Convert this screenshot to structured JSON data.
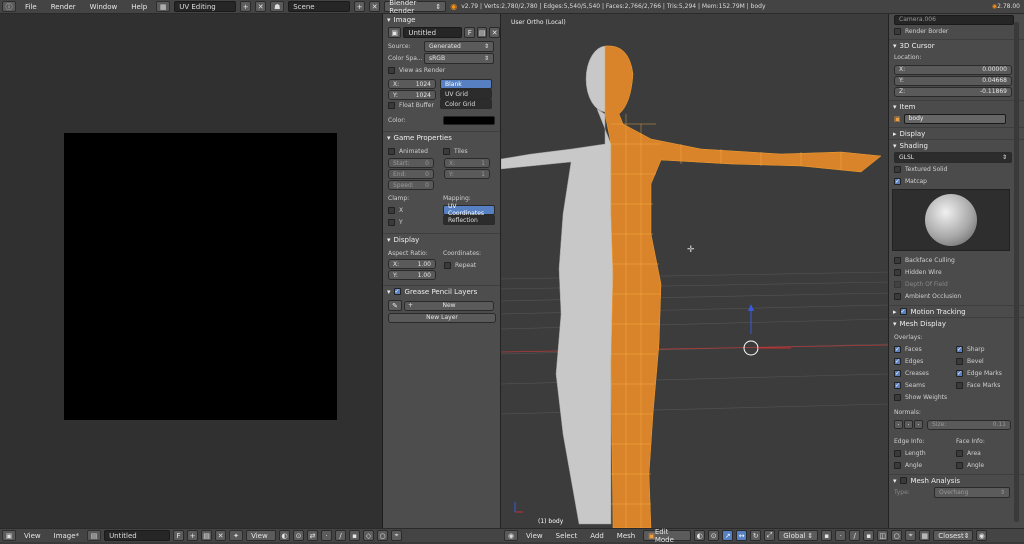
{
  "topbar": {
    "menus": [
      "File",
      "Render",
      "Window",
      "Help"
    ],
    "layout": "UV Editing",
    "scene": "Scene",
    "engine": "Blender Render",
    "stats": "v2.79 | Verts:2,780/2,780 | Edges:5,540/5,540 | Faces:2,766/2,766 | Tris:5,294 | Mem:152.79M | body",
    "version": "2.78.00"
  },
  "image_panel": {
    "header": "Image",
    "image_name": "Untitled",
    "source_label": "Source:",
    "source_value": "Generated",
    "colorspace_label": "Color Spa...",
    "colorspace_value": "sRGB",
    "view_as_render": "View as Render",
    "x_label": "X:",
    "x_value": "1024",
    "y_label": "Y:",
    "y_value": "1024",
    "gen_types": [
      "Blank",
      "UV Grid",
      "Color Grid"
    ],
    "float_buffer": "Float Buffer",
    "color_label": "Color:"
  },
  "game_panel": {
    "header": "Game Properties",
    "animated": "Animated",
    "tiles": "Tiles",
    "start": "Start:",
    "start_val": "0",
    "end": "End:",
    "end_val": "0",
    "speed": "Speed:",
    "speed_val": "0",
    "tx": "X:",
    "tx_val": "1",
    "ty": "Y:",
    "ty_val": "1",
    "clamp": "Clamp:",
    "mapping": "Mapping:",
    "cx": "X",
    "cy": "Y",
    "map_uv": "UV Coordinates",
    "map_refl": "Reflection"
  },
  "display_panel": {
    "header": "Display",
    "aspect": "Aspect Ratio:",
    "coords": "Coordinates:",
    "ax": "X:",
    "ax_val": "1.00",
    "ay": "Y:",
    "ay_val": "1.00",
    "repeat": "Repeat"
  },
  "gp_panel": {
    "header": "Grease Pencil Layers",
    "new": "New",
    "new_layer": "New Layer"
  },
  "viewport": {
    "title": "User Ortho (Local)",
    "object_label": "(1) body"
  },
  "npanel": {
    "camera": "Camera.006",
    "render_border": "Render Border",
    "cursor_header": "3D Cursor",
    "location": "Location:",
    "cx": "X:",
    "cx_val": "0.00000",
    "cy": "Y:",
    "cy_val": "0.04668",
    "cz": "Z:",
    "cz_val": "-0.11869",
    "item_header": "Item",
    "item_name": "body",
    "display_header": "Display",
    "shading_header": "Shading",
    "shading_mode": "GLSL",
    "textured_solid": "Textured Solid",
    "matcap": "Matcap",
    "backface": "Backface Culling",
    "hidden_wire": "Hidden Wire",
    "dof": "Depth Of Field",
    "ao": "Ambient Occlusion",
    "motion_tracking": "Motion Tracking",
    "mesh_display": "Mesh Display",
    "overlays": "Overlays:",
    "faces": "Faces",
    "sharp": "Sharp",
    "edges": "Edges",
    "bevel": "Bevel",
    "creases": "Creases",
    "edge_marks": "Edge Marks",
    "seams": "Seams",
    "face_marks": "Face Marks",
    "show_weights": "Show Weights",
    "normals": "Normals:",
    "size": "Size:",
    "size_val": "0.11",
    "edge_info": "Edge Info:",
    "face_info": "Face Info:",
    "length": "Length",
    "area": "Area",
    "angle1": "Angle",
    "angle2": "Angle",
    "mesh_analysis": "Mesh Analysis",
    "type": "Type:",
    "type_val": "Overhang"
  },
  "bottombar": {
    "left_menus": [
      "View",
      "Image*"
    ],
    "image_name": "Untitled",
    "view_dd": "View",
    "right_menus": [
      "View",
      "Select",
      "Add",
      "Mesh"
    ],
    "mode": "Edit Mode",
    "orientation": "Global",
    "snap": "Closest"
  },
  "colors": {
    "accent": "#5680c2",
    "mesh_orange": "#f0901c",
    "body_gray": "#c8c8c8"
  }
}
